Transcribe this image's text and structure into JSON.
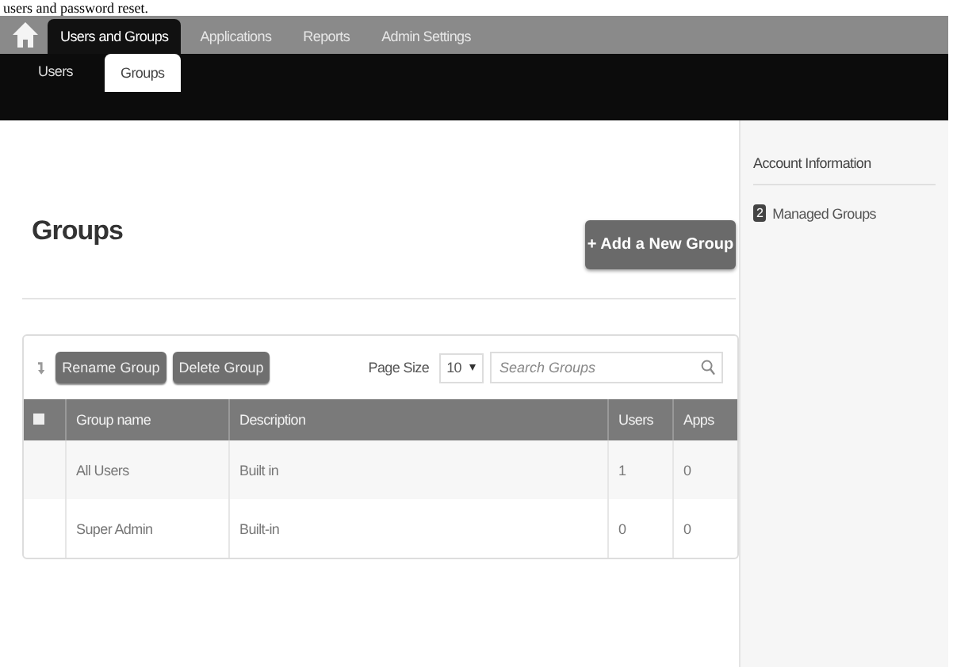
{
  "caption": "users and password reset.",
  "nav": {
    "tabs": [
      {
        "label": "Users and Groups",
        "selected": true
      },
      {
        "label": "Applications",
        "selected": false
      },
      {
        "label": "Reports",
        "selected": false
      },
      {
        "label": "Admin Settings",
        "selected": false
      }
    ],
    "subtabs": [
      {
        "label": "Users",
        "selected": false
      },
      {
        "label": "Groups",
        "selected": true
      }
    ]
  },
  "page": {
    "title": "Groups",
    "add_button": "+ Add a New Group"
  },
  "toolbar": {
    "buttons": [
      "Rename Group",
      "Delete Group"
    ],
    "page_size_label": "Page Size",
    "page_size": "10",
    "search": {
      "placeholder": "Search Groups"
    }
  },
  "table": {
    "columns": [
      "Group name",
      "Description",
      "Users",
      "Apps"
    ],
    "rows": [
      {
        "cells": [
          "All Users",
          "Built in",
          "1",
          "0"
        ]
      },
      {
        "cells": [
          "Super Admin",
          "Built-in",
          "0",
          "0"
        ]
      }
    ]
  },
  "sidebar": {
    "title": "Account Information",
    "items": [
      {
        "count": "2",
        "label": "Managed Groups"
      }
    ]
  }
}
